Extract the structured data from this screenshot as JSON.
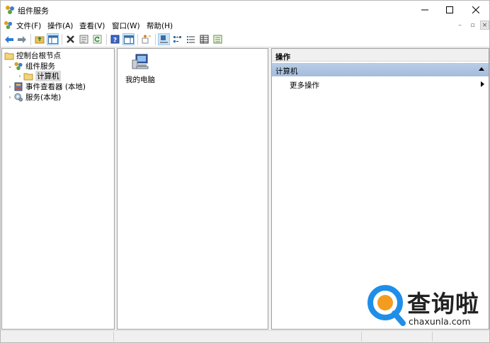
{
  "window": {
    "title": "组件服务",
    "controls": {
      "minimize_icon": "minimize-icon",
      "maximize_icon": "maximize-icon",
      "close_icon": "close-icon"
    }
  },
  "menu": {
    "items": [
      "文件(F)",
      "操作(A)",
      "查看(V)",
      "窗口(W)",
      "帮助(H)"
    ]
  },
  "toolbar": {
    "buttons": [
      "back-icon",
      "forward-icon",
      "up-folder-icon",
      "show-hide-tree-icon",
      "delete-icon",
      "properties-icon",
      "refresh-icon",
      "help-icon",
      "show-action-pane-icon",
      "export-list-icon",
      "large-icons-view-icon",
      "small-icons-view-icon",
      "list-view-icon",
      "detail-view-icon",
      "configure-icon"
    ]
  },
  "tree": {
    "root": "控制台根节点",
    "nodes": [
      {
        "label": "组件服务",
        "expanded": true
      },
      {
        "label": "计算机",
        "selected": true
      },
      {
        "label": "事件查看器 (本地)"
      },
      {
        "label": "服务(本地)"
      }
    ]
  },
  "list": {
    "items": [
      {
        "label": "我的电脑",
        "icon": "my-computer-icon"
      }
    ]
  },
  "actions": {
    "header": "操作",
    "section": "计算机",
    "item": "更多操作"
  },
  "watermark": {
    "brand_cn": "查询啦",
    "brand_en": "chaxunla.com",
    "colors": {
      "blue": "#1f8ee8",
      "orange": "#f39c1f"
    }
  }
}
